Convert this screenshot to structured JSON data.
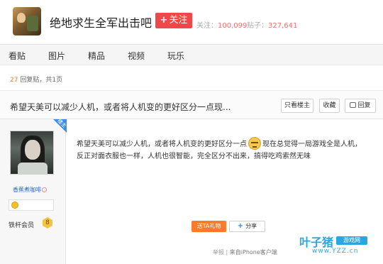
{
  "forum": {
    "name": "绝地求生全军出击吧",
    "follow_label": "关注",
    "follow_plus": "+",
    "stats": {
      "followers_label": "关注：",
      "followers_value": "100,099",
      "posts_label": "贴子：",
      "posts_value": "327,641"
    }
  },
  "nav": {
    "items": [
      "看贴",
      "图片",
      "精品",
      "视频",
      "玩乐"
    ]
  },
  "pager": {
    "reply_count": "27",
    "reply_label": "回复贴，共",
    "page_count": "1",
    "page_suffix": "页"
  },
  "thread": {
    "title": "希望天美可以减少人机，或者将人机变的更好区分一点现...",
    "buttons": {
      "only_op": "只看楼主",
      "favorite": "收藏",
      "reply": "回复"
    }
  },
  "post": {
    "author": "香蕉煮咖啡",
    "op_badge": "楼主",
    "level_label": "铁杆会员",
    "level_value": "8",
    "text_line1_a": "希望天美可以减少人机，或者将人机变的更好区分一点",
    "text_line1_b": "现在总觉得一局游戏全是人机，",
    "text_line2": "反正对面衣服也一样，人机也很智能，完全区分不出来，搞得吃鸡索然无味",
    "gift_label": "送TA礼物",
    "share_label": "分享",
    "share_plus": "+",
    "report_label": "举报",
    "separator": "|",
    "source": "来自iPhone客户端"
  },
  "watermark": {
    "brand": "叶子猪",
    "tag": "游戏网",
    "url": "www.YZZ.cn"
  },
  "colors": {
    "follow_red": "#f04848",
    "link_blue": "#2b68c8",
    "orange": "#ff7a2a",
    "watermark_blue": "#29a7e0"
  },
  "icons": {
    "emoji": "sad-emoji-icon",
    "gender": "female-icon",
    "badge": "medal-icon",
    "level": "level-shield-icon"
  }
}
